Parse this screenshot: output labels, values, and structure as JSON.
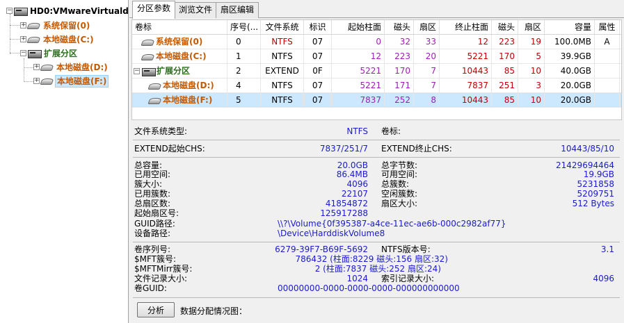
{
  "tree": {
    "root": "HD0:VMwareVirtualdi",
    "items": [
      {
        "label": "系统保留(0)"
      },
      {
        "label": "本地磁盘(C:)"
      },
      {
        "label": "扩展分区"
      },
      {
        "label": "本地磁盘(D:)"
      },
      {
        "label": "本地磁盘(F:)"
      }
    ]
  },
  "tabs": [
    "分区参数",
    "浏览文件",
    "扇区编辑"
  ],
  "grid": {
    "columns": [
      "卷标",
      "序号(...",
      "文件系统",
      "标识",
      "起始柱面",
      "磁头",
      "扇区",
      "终止柱面",
      "磁头",
      "扇区",
      "容量",
      "属性"
    ],
    "rows": [
      {
        "label": "系统保留(0)",
        "index": "0",
        "fs": "NTFS",
        "id": "07",
        "start_cyl": "0",
        "start_head": "32",
        "start_sec": "33",
        "end_cyl": "12",
        "end_head": "223",
        "end_sec": "19",
        "size": "100.0MB",
        "attr": "A"
      },
      {
        "label": "本地磁盘(C:)",
        "index": "1",
        "fs": "NTFS",
        "id": "07",
        "start_cyl": "12",
        "start_head": "223",
        "start_sec": "20",
        "end_cyl": "5221",
        "end_head": "170",
        "end_sec": "5",
        "size": "39.9GB",
        "attr": ""
      },
      {
        "label": "扩展分区",
        "index": "2",
        "fs": "EXTEND",
        "id": "0F",
        "start_cyl": "5221",
        "start_head": "170",
        "start_sec": "7",
        "end_cyl": "10443",
        "end_head": "85",
        "end_sec": "10",
        "size": "40.0GB",
        "attr": ""
      },
      {
        "label": "本地磁盘(D:)",
        "index": "4",
        "fs": "NTFS",
        "id": "07",
        "start_cyl": "5221",
        "start_head": "171",
        "start_sec": "7",
        "end_cyl": "7837",
        "end_head": "251",
        "end_sec": "3",
        "size": "20.0GB",
        "attr": ""
      },
      {
        "label": "本地磁盘(F:)",
        "index": "5",
        "fs": "NTFS",
        "id": "07",
        "start_cyl": "7837",
        "start_head": "252",
        "start_sec": "8",
        "end_cyl": "10443",
        "end_head": "85",
        "end_sec": "10",
        "size": "20.0GB",
        "attr": ""
      }
    ]
  },
  "info": {
    "fs_type_label": "文件系统类型:",
    "fs_type": "NTFS",
    "vol_label_label": "卷标:",
    "ext_start_label": "EXTEND起始CHS:",
    "ext_start": "7837/251/7",
    "ext_end_label": "EXTEND终止CHS:",
    "ext_end": "10443/85/10",
    "total_cap_label": "总容量:",
    "total_cap": "20.0GB",
    "total_bytes_label": "总字节数:",
    "total_bytes": "21429694464",
    "used_label": "已用空间:",
    "used": "86.4MB",
    "free_label": "可用空间:",
    "free": "19.9GB",
    "cluster_size_label": "簇大小:",
    "cluster_size": "4096",
    "total_clusters_label": "总簇数:",
    "total_clusters": "5231858",
    "used_clusters_label": "已用簇数:",
    "used_clusters": "22107",
    "free_clusters_label": "空闲簇数:",
    "free_clusters": "5209751",
    "total_sectors_label": "总扇区数:",
    "total_sectors": "41854872",
    "sector_size_label": "扇区大小:",
    "sector_size": "512 Bytes",
    "start_sector_label": "起始扇区号:",
    "start_sector": "125917288",
    "guid_path_label": "GUID路径:",
    "guid_path": "\\\\?\\Volume{0f395387-a4ce-11ec-ae6b-000c2982af77}",
    "device_path_label": "设备路径:",
    "device_path": "\\Device\\HarddiskVolume8",
    "serial_label": "卷序列号:",
    "serial": "6279-39F7-B69F-5692",
    "ntfs_ver_label": "NTFS版本号:",
    "ntfs_ver": "3.1",
    "mft_label": "$MFT簇号:",
    "mft": "786432 (柱面:8229 磁头:156 扇区:32)",
    "mftmirr_label": "$MFTMirr簇号:",
    "mftmirr": "2 (柱面:7837 磁头:252 扇区:24)",
    "record_size_label": "文件记录大小:",
    "record_size": "1024",
    "index_size_label": "索引记录大小:",
    "index_size": "4096",
    "vol_guid_label": "卷GUID:",
    "vol_guid": "00000000-0000-0000-0000-000000000000"
  },
  "footer": {
    "analyze_button": "分析",
    "alloc_label": "数据分配情况图："
  }
}
